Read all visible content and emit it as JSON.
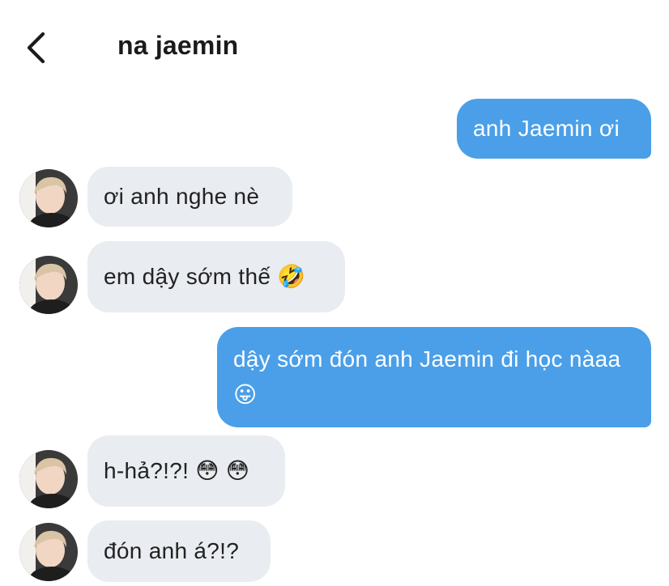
{
  "header": {
    "back_icon": "chevron-left-icon",
    "contact_name": "na jaemin"
  },
  "messages": [
    {
      "direction": "outgoing",
      "text": "anh Jaemin ơi"
    },
    {
      "direction": "incoming",
      "text": "ơi anh nghe nè"
    },
    {
      "direction": "incoming",
      "text": "em dậy sớm thế 🤣"
    },
    {
      "direction": "outgoing",
      "text": "dậy sớm đón anh Jaemin đi học nàaa 😛"
    },
    {
      "direction": "incoming",
      "text": "h-hả?!?! 😳 😳"
    },
    {
      "direction": "incoming",
      "text": "đón anh á?!?"
    }
  ],
  "colors": {
    "outgoing_bubble": "#4a9fe8",
    "incoming_bubble": "#e9ecf0",
    "outgoing_text": "#ffffff",
    "incoming_text": "#222222"
  }
}
